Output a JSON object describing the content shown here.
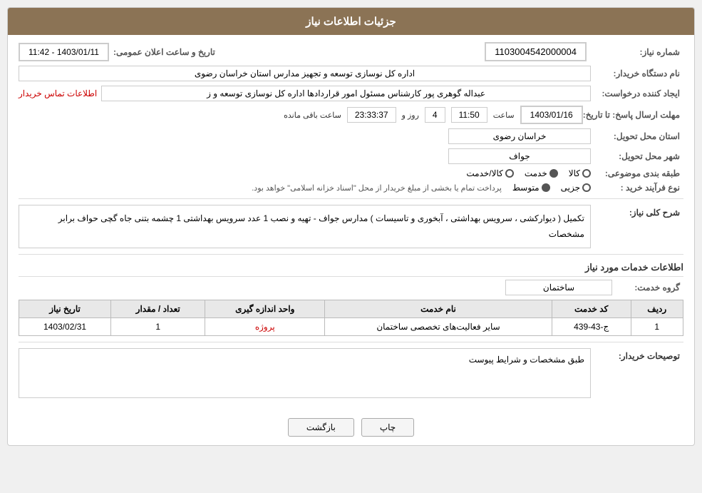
{
  "header": {
    "title": "جزئیات اطلاعات نیاز"
  },
  "fields": {
    "shomareNiaz_label": "شماره نیاز:",
    "shomareNiaz_value": "1103004542000004",
    "namDastgah_label": "نام دستگاه خریدار:",
    "namDastgah_value": "اداره کل نوسازی  توسعه و تجهیز مدارس استان خراسان رضوی",
    "ijadKonande_label": "ایجاد کننده درخواست:",
    "ijadKonande_value": "عبداله گوهری پور کارشناس مسئول امور قراردادها  اداره کل نوسازی  توسعه و ز",
    "ijadKonande_link": "اطلاعات تماس خریدار",
    "mohlat_label": "مهلت ارسال پاسخ: تا تاریخ:",
    "date_value": "1403/01/16",
    "time_label": "ساعت",
    "time_value": "11:50",
    "days_label": "روز و",
    "days_value": "4",
    "timer_label": "ساعت باقی مانده",
    "timer_value": "23:33:37",
    "ostan_label": "استان محل تحویل:",
    "ostan_value": "خراسان رضوی",
    "shahr_label": "شهر محل تحویل:",
    "shahr_value": "جواف",
    "tabaqe_label": "طبقه بندی موضوعی:",
    "tabaqe_options": [
      "کالا",
      "خدمت",
      "کالا/خدمت"
    ],
    "tabaqe_selected": "خدمت",
    "noeFarayand_label": "نوع فرآیند خرید :",
    "noeFarayand_options": [
      "جزیی",
      "متوسط"
    ],
    "noeFarayand_selected": "متوسط",
    "noeFarayand_note": "پرداخت تمام یا بخشی از مبلغ خریدار از محل \"اسناد خزانه اسلامی\" خواهد بود.",
    "sharhKoli_label": "شرح کلی نیاز:",
    "sharhKoli_value": "تکمیل ( دیوارکشی ، سرویس بهداشتی ، آبخوری و تاسیسات ) مدارس جواف - تهیه و نصب 1 عدد سرویس بهداشتی 1 چشمه بتنی جاه گچی حواف برابر مشخصات",
    "taarikheElan_label": "تاریخ و ساعت اعلان عمومی:",
    "taarikheElan_value": "1403/01/11 - 11:42",
    "khadamat_title": "اطلاعات خدمات مورد نیاز",
    "geroheKhedmat_label": "گروه خدمت:",
    "geroheKhedmat_value": "ساختمان",
    "table": {
      "headers": [
        "ردیف",
        "کد خدمت",
        "نام خدمت",
        "واحد اندازه گیری",
        "تعداد / مقدار",
        "تاریخ نیاز"
      ],
      "rows": [
        {
          "radif": "1",
          "kodKhedmat": "ج-43-439",
          "namKhedmat": "سایر فعالیت‌های تخصصی ساختمان",
          "vahed": "پروژه",
          "tedad": "1",
          "tarikh": "1403/02/31"
        }
      ]
    },
    "tosifKharidar_label": "توصیحات خریدار:",
    "tosifKharidar_value": "طبق مشخصات و شرایط پیوست"
  },
  "buttons": {
    "print_label": "چاپ",
    "back_label": "بازگشت"
  }
}
